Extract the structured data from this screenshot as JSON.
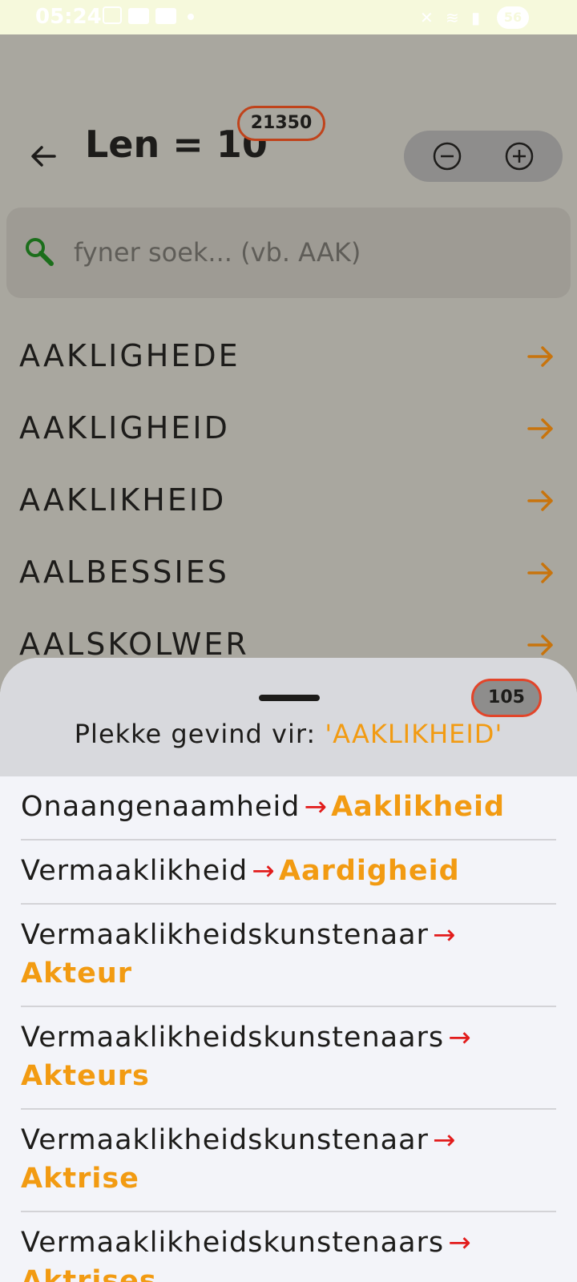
{
  "status_bar": {
    "time": "05:24",
    "battery": "56"
  },
  "header": {
    "title": "Len = 10",
    "count_badge": "21350"
  },
  "search": {
    "placeholder": "fyner soek... (vb. AAK)"
  },
  "words": [
    {
      "label": "AAKLIGHEDE"
    },
    {
      "label": "AAKLIGHEID"
    },
    {
      "label": "AAKLIKHEID"
    },
    {
      "label": "AALBESSIES"
    },
    {
      "label": "AALSKOLWER"
    }
  ],
  "sheet": {
    "badge": "105",
    "title_prefix": "Plekke gevind vir: ",
    "title_word": "'AAKLIKHEID'",
    "results": [
      {
        "src": "Onaangenaamheid",
        "arrow": "→",
        "dst": "Aaklikheid"
      },
      {
        "src": "Vermaaklikheid",
        "arrow": "→",
        "dst": "Aardigheid"
      },
      {
        "src": "Vermaaklikheidskunstenaar",
        "arrow": "→",
        "dst": "Akteur"
      },
      {
        "src": "Vermaaklikheidskunstenaars",
        "arrow": "→",
        "dst": "Akteurs"
      },
      {
        "src": "Vermaaklikheidskunstenaar",
        "arrow": "→",
        "dst": "Aktrise"
      },
      {
        "src": "Vermaaklikheidskunstenaars",
        "arrow": "→",
        "dst": "Aktrises"
      }
    ]
  },
  "colors": {
    "accent": "#f29b12",
    "arrow_red": "#e21b1b",
    "badge_border": "#c0431b"
  }
}
